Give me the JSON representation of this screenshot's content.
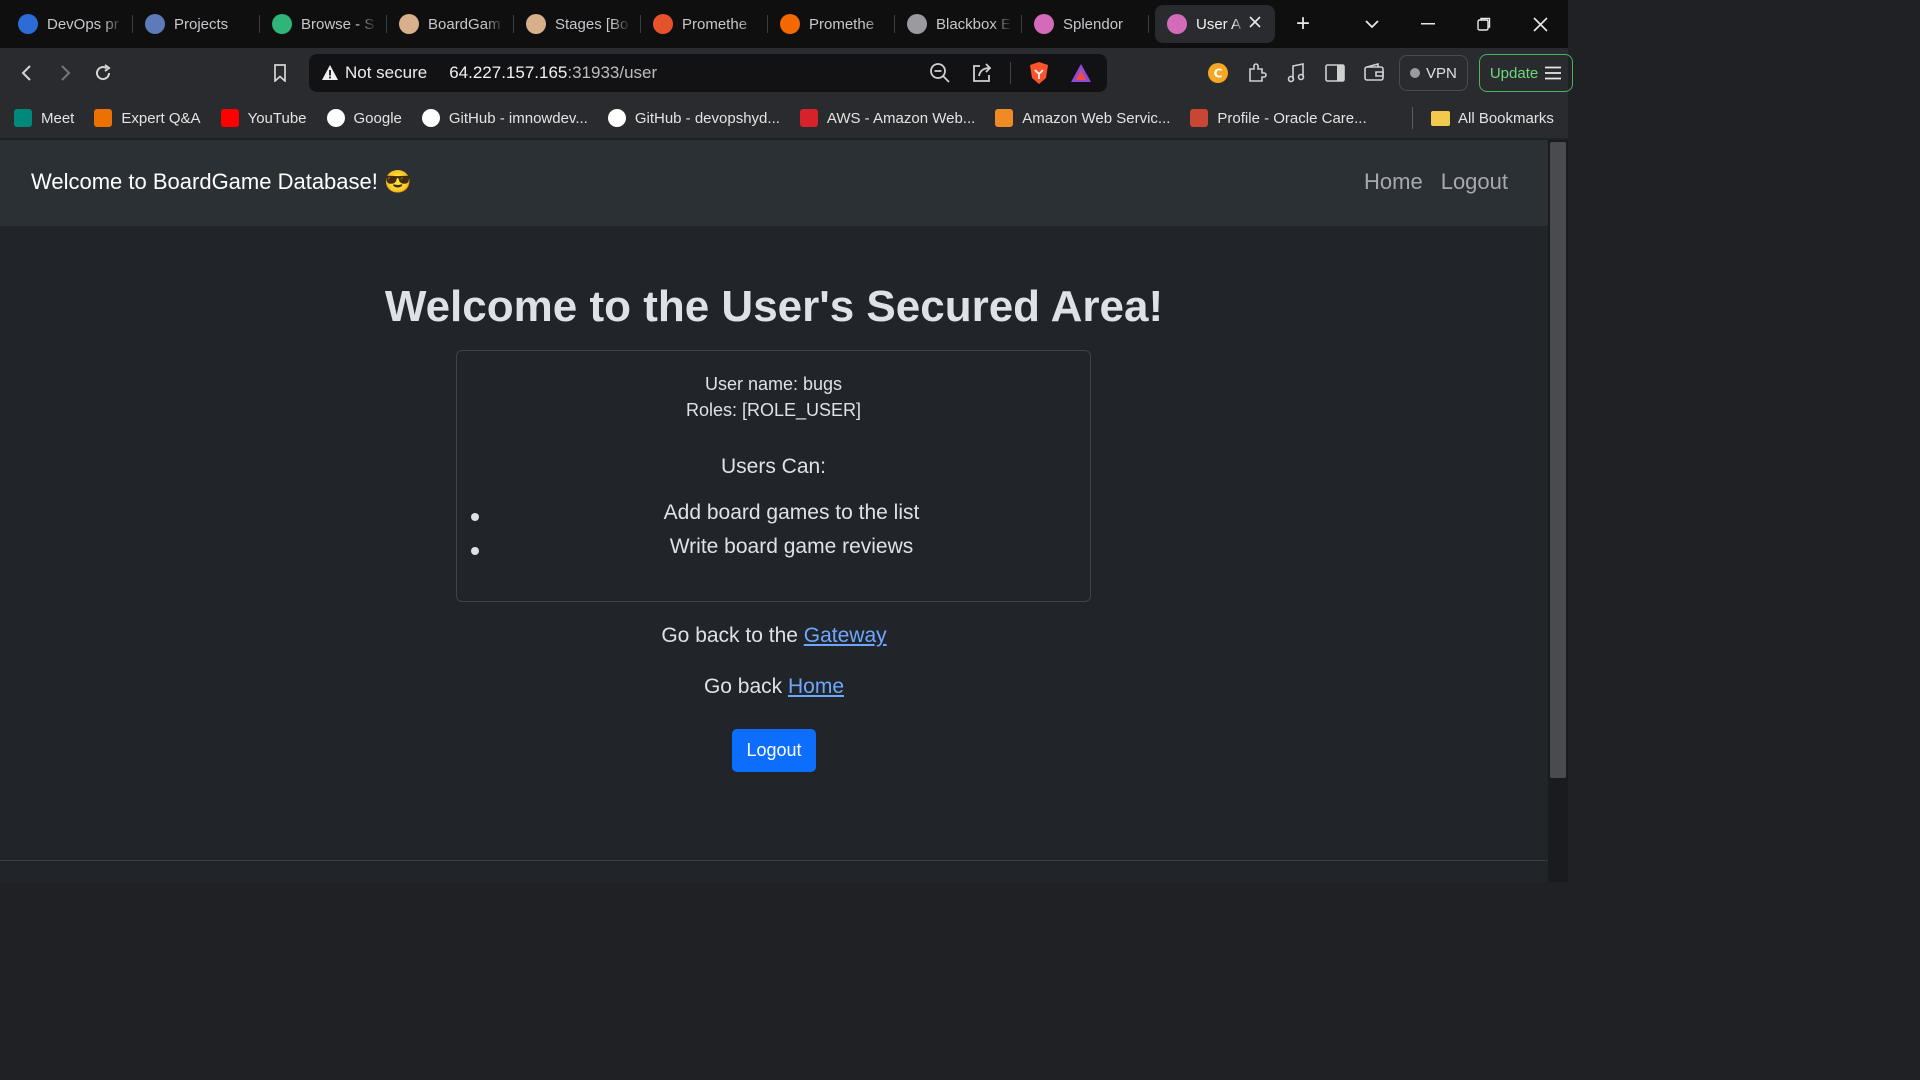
{
  "browser": {
    "tabs": [
      {
        "title": "DevOps pr",
        "icon": "devops-icon",
        "color": "#2b6cd6"
      },
      {
        "title": "Projects",
        "icon": "projects-icon",
        "color": "#5f7ab8"
      },
      {
        "title": "Browse - S",
        "icon": "sonar-icon",
        "color": "#2fb57a"
      },
      {
        "title": "BoardGam",
        "icon": "jenkins-icon",
        "color": "#d8b08c"
      },
      {
        "title": "Stages [Bo",
        "icon": "jenkins-icon",
        "color": "#d8b08c"
      },
      {
        "title": "Promethe",
        "icon": "prometheus-icon",
        "color": "#e6522c"
      },
      {
        "title": "Promethe",
        "icon": "grafana-icon",
        "color": "#f46800"
      },
      {
        "title": "Blackbox E",
        "icon": "globe-icon",
        "color": "#9a9aa0"
      },
      {
        "title": "Splendor",
        "icon": "mb-icon",
        "color": "#d46bb8"
      },
      {
        "title": "User A",
        "icon": "mb-icon",
        "color": "#d46bb8",
        "active": true
      }
    ],
    "url": {
      "security": "Not secure",
      "host": "64.227.157.165",
      "path": ":31933/user"
    },
    "vpn_label": "VPN",
    "update_label": "Update",
    "bookmarks": [
      {
        "label": "Meet",
        "icon": "meet-icon",
        "color": "#00897b"
      },
      {
        "label": "Expert Q&A",
        "icon": "chegg-icon",
        "color": "#eb7100"
      },
      {
        "label": "YouTube",
        "icon": "youtube-icon",
        "color": "#ff0000"
      },
      {
        "label": "Google",
        "icon": "google-icon",
        "color": "#ffffff"
      },
      {
        "label": "GitHub - imnowdev...",
        "icon": "github-icon",
        "color": "#ffffff"
      },
      {
        "label": "GitHub - devopshyd...",
        "icon": "github-icon",
        "color": "#ffffff"
      },
      {
        "label": "AWS - Amazon Web...",
        "icon": "aws-icon",
        "color": "#d8222a"
      },
      {
        "label": "Amazon Web Servic...",
        "icon": "aws-box-icon",
        "color": "#f08a24"
      },
      {
        "label": "Profile - Oracle Care...",
        "icon": "oracle-icon",
        "color": "#c74634"
      }
    ],
    "all_bookmarks_label": "All Bookmarks"
  },
  "site": {
    "brand": "Welcome to BoardGame Database! 😎",
    "nav": {
      "home": "Home",
      "logout": "Logout"
    },
    "title": "Welcome to the User's Secured Area!",
    "card": {
      "username": "User name: bugs",
      "roles": "Roles: [ROLE_USER]",
      "can_heading": "Users Can:",
      "abilities": [
        "Add board games to the list",
        "Write board game reviews"
      ]
    },
    "gateway_prefix": "Go back to the ",
    "gateway_link": "Gateway",
    "home_prefix": "Go back ",
    "home_link": "Home",
    "logout_button": "Logout"
  }
}
